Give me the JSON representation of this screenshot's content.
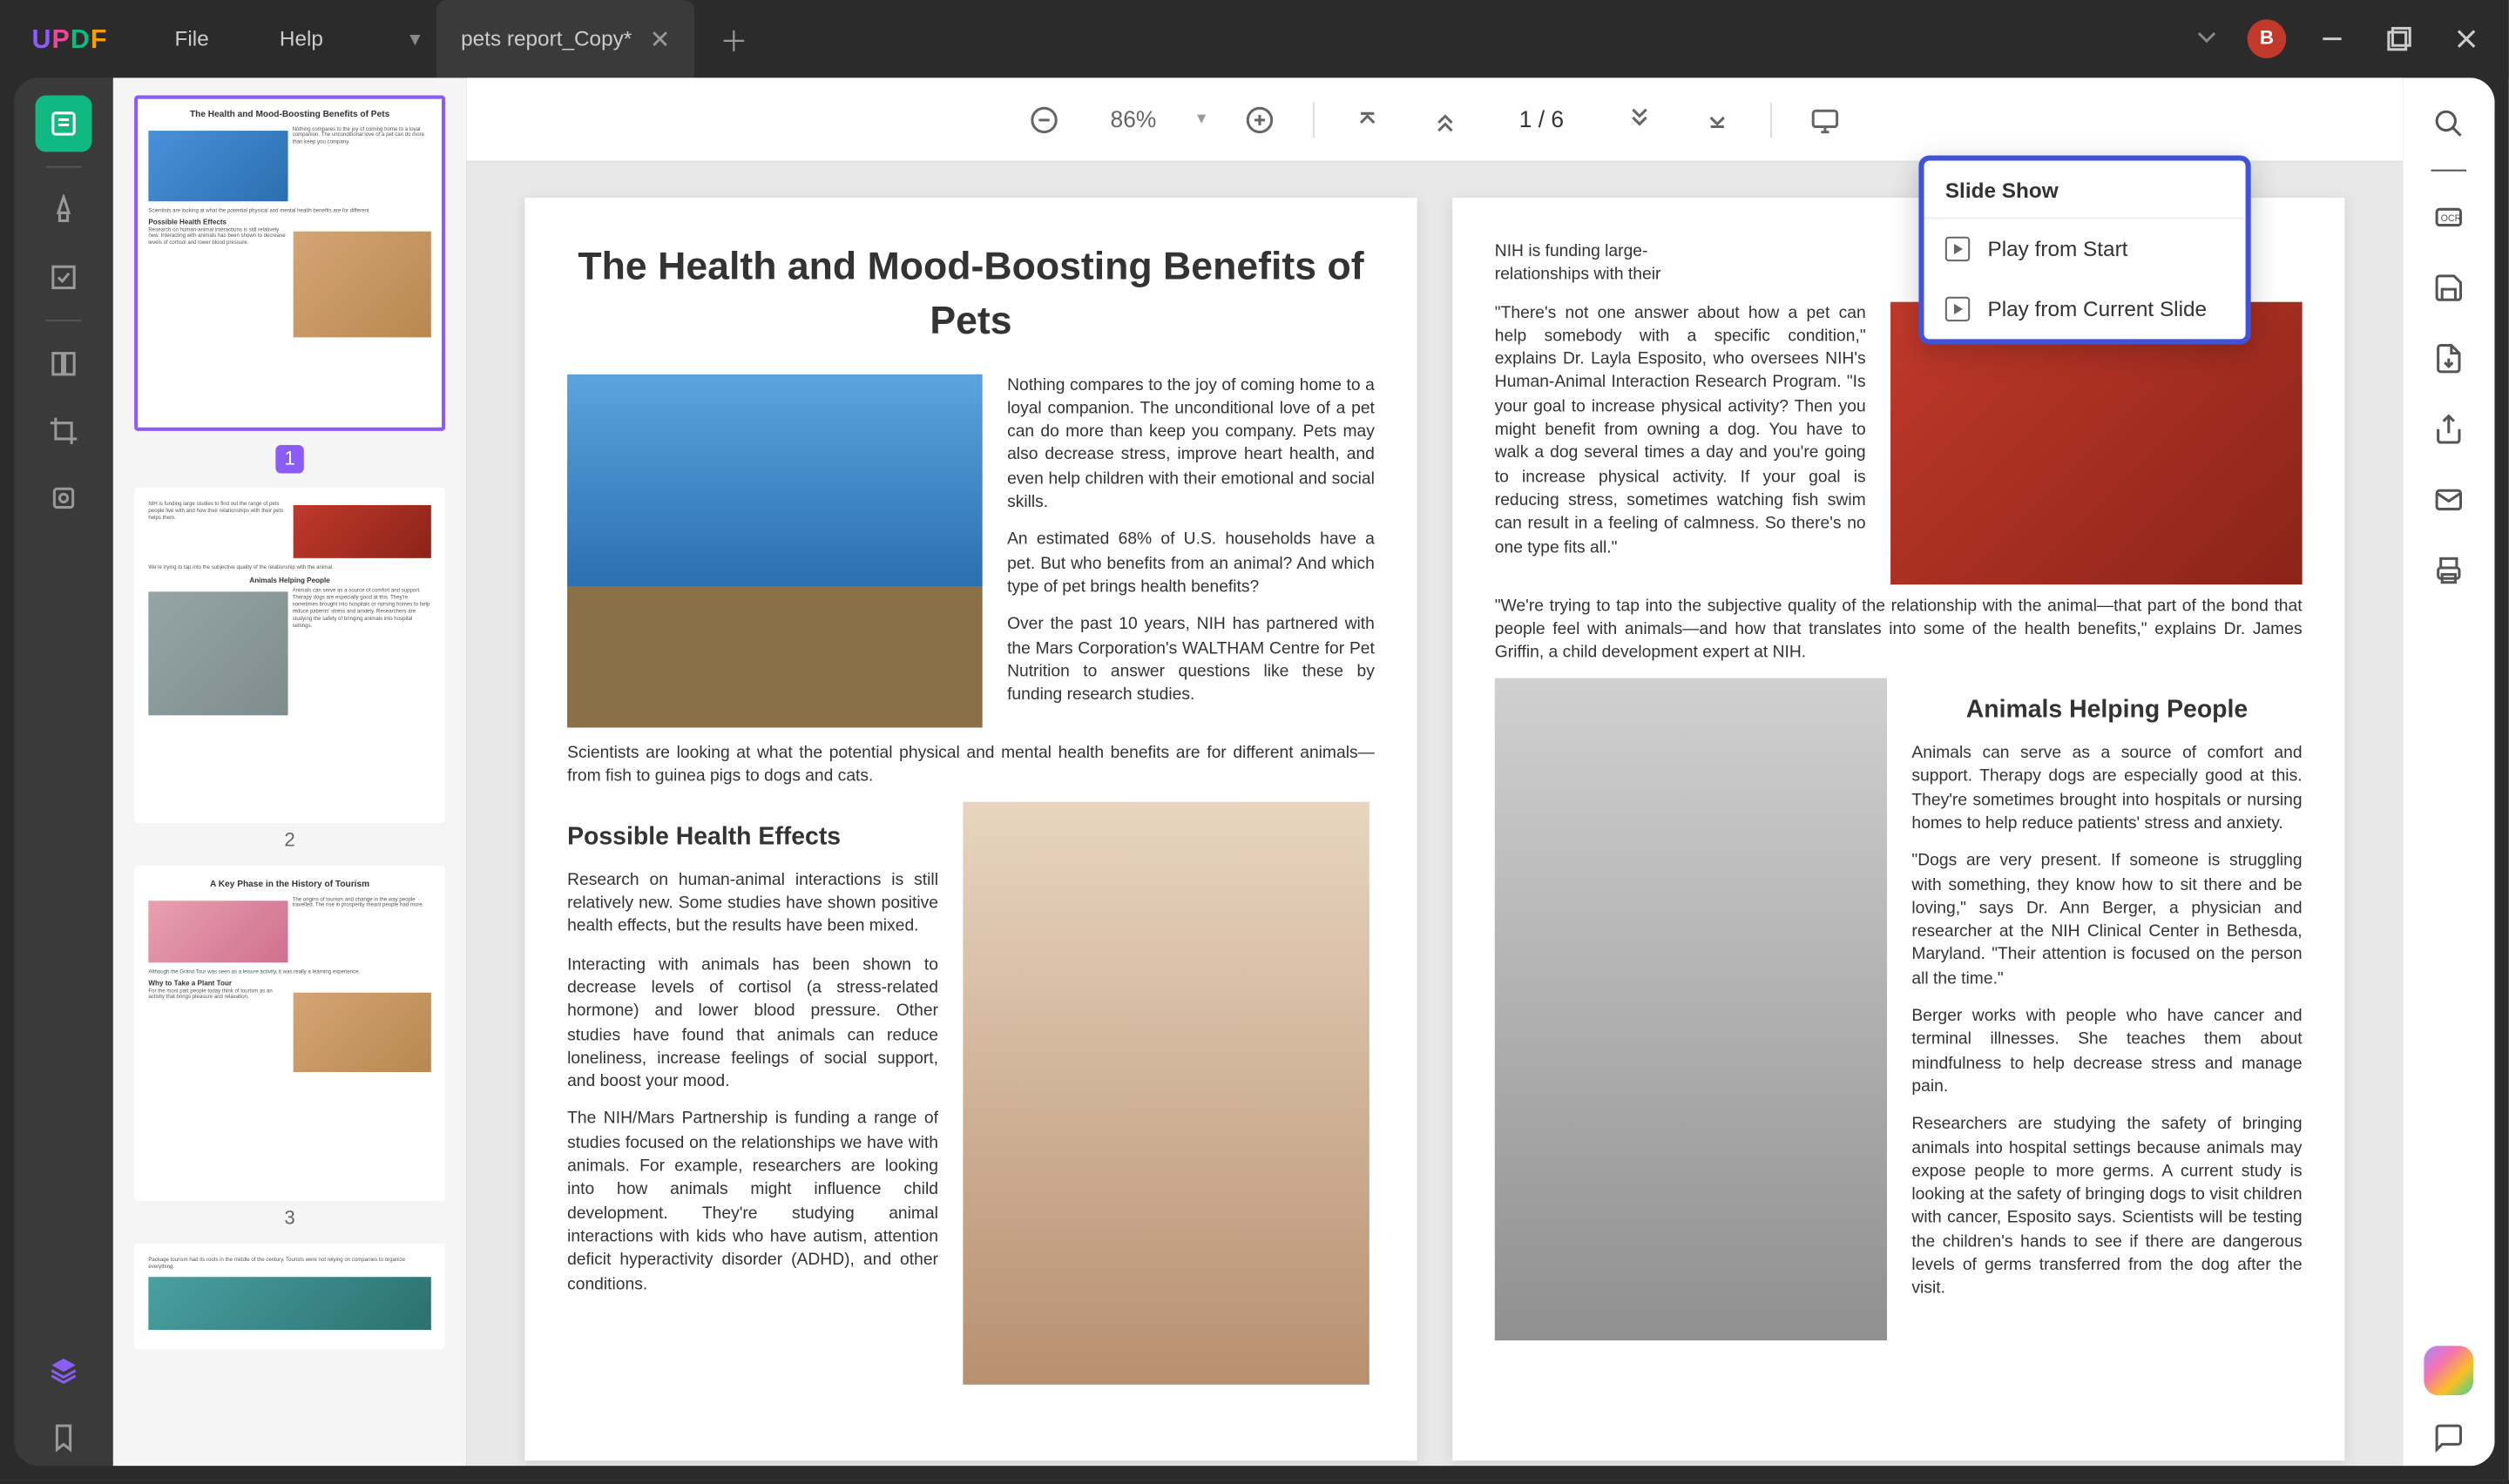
{
  "titlebar": {
    "menu": {
      "file": "File",
      "help": "Help"
    },
    "tab_name": "pets report_Copy*",
    "avatar_letter": "B"
  },
  "toolbar": {
    "zoom": "86%",
    "page_indicator": "1  /  6"
  },
  "popover": {
    "title": "Slide Show",
    "item_start": "Play from Start",
    "item_current": "Play from Current Slide"
  },
  "thumbs": {
    "p1": "1",
    "p2": "2",
    "p3": "3",
    "t1": "The Health and Mood-Boosting Benefits of Pets",
    "t3": "A Key Phase in the History of Tourism",
    "t2_heading": "Animals Helping People",
    "t3_heading": "Why to Take a Plant Tour"
  },
  "page1": {
    "title": "The Health and Mood-Boosting Benefits of Pets",
    "p1": "Nothing compares to the joy of coming home to a loyal companion. The unconditional love of a pet can do more than keep you company. Pets may also decrease stress, improve heart health, and even help children with their emotional and social skills.",
    "p2": "An estimated 68% of U.S. households have a pet. But who benefits from an animal? And which type of pet brings health benefits?",
    "p3": "Over the past 10 years, NIH has partnered with the Mars Corporation's WALTHAM Centre for Pet Nutrition to answer questions like these by funding research studies.",
    "p4": "Scientists are looking at what the potential physical and mental health benefits are for different animals—from fish to guinea pigs to dogs and cats.",
    "h2": "Possible Health Effects",
    "p5": "Research on human-animal interactions is still relatively new. Some studies have shown positive health effects, but the results have been mixed.",
    "p6": "Interacting with animals has been shown to decrease levels of cortisol (a stress-related hormone) and lower blood pressure. Other studies have found that animals can reduce loneliness, increase feelings of social support, and boost your mood.",
    "p7": "The NIH/Mars Partnership is funding a range of studies focused on the relationships we have with animals. For example, researchers are looking into how animals might influence child development. They're studying animal interactions with kids who have autism, attention deficit hyperactivity disorder (ADHD), and other conditions."
  },
  "page2": {
    "p1a": "NIH is funding large-",
    "p1b": "s people live with and how their",
    "p1c": "relationships with their",
    "p2": "\"There's not one answer about how a pet can help somebody with a specific condition,\" explains Dr. Layla Esposito, who oversees NIH's Human-Animal Interaction Research Program. \"Is your goal to increase physical activity? Then you might benefit from owning a dog. You have to walk a dog several times a day and you're going to increase physical activity. If your goal is reducing stress, sometimes watching fish swim can result in a feeling of calmness. So there's no one type fits all.\"",
    "p3": "\"We're trying to tap into the subjective quality of the relationship with the animal—that part of the bond that people feel with animals—and how that translates into some of the health benefits,\" explains Dr. James Griffin, a child development expert at NIH.",
    "h3": "Animals Helping People",
    "p4": "Animals can serve as a source of comfort and support. Therapy dogs are especially good at this. They're sometimes brought into hospitals or nursing homes to help reduce patients' stress and anxiety.",
    "p5": "\"Dogs are very present. If someone is struggling with something, they know how to sit there and be loving,\" says Dr. Ann Berger, a physician and researcher at the NIH Clinical Center in Bethesda, Maryland. \"Their attention is focused on the person all the time.\"",
    "p6": "Berger works with people who have cancer and terminal illnesses. She teaches them about mindfulness to help decrease stress and manage pain.",
    "p7": "Researchers are studying the safety of bringing animals into hospital settings because animals may expose people to more germs. A current study is looking at the safety of bringing dogs to visit children with cancer, Esposito says. Scientists will be testing the children's hands to see if there are dangerous levels of germs transferred from the dog after the visit."
  }
}
